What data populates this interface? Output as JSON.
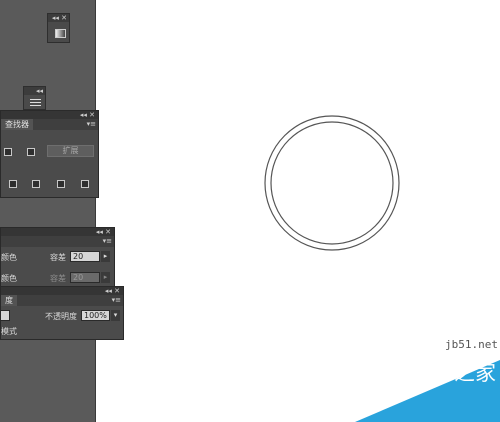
{
  "pathfinder": {
    "tab": "查找器",
    "expand_button": "扩展"
  },
  "stroke": {
    "row1": {
      "label": "颜色",
      "field_label": "容差",
      "value": "20"
    },
    "row2": {
      "label": "颜色",
      "field_label": "容差",
      "value": "20"
    }
  },
  "transparency": {
    "tab": "度",
    "opacity_label": "不透明度",
    "opacity_value": "100%",
    "mode_label": "模式"
  },
  "window_controls": {
    "collapse": "◂◂",
    "close": "✕",
    "menu": "▾≡"
  },
  "watermark": {
    "site": "jb51.net",
    "brand": "脚本之家"
  },
  "colors": {
    "dock": "#5a5a5a",
    "panel": "#4b4b4b",
    "watermark_blue": "#29a3dc"
  }
}
